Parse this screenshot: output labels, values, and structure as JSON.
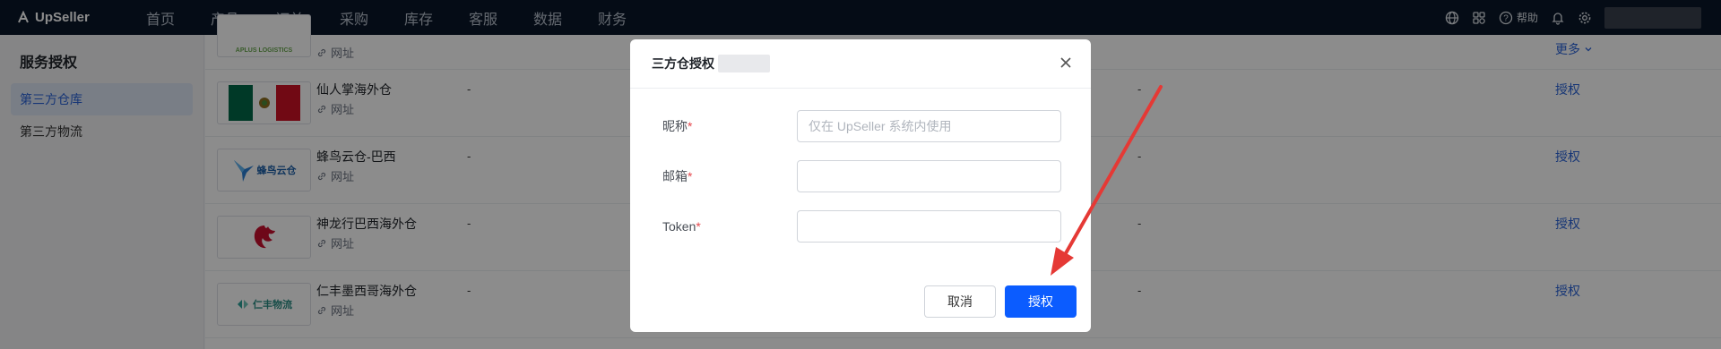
{
  "brand": {
    "name": "UpSeller"
  },
  "nav": [
    "首页",
    "产品",
    "订单",
    "采购",
    "库存",
    "客服",
    "数据",
    "财务"
  ],
  "top_right": {
    "help_label": "帮助"
  },
  "sidebar": {
    "title": "服务授权",
    "items": [
      {
        "label": "第三方仓库",
        "active": true
      },
      {
        "label": "第三方物流",
        "active": false
      }
    ]
  },
  "table": {
    "more_label": "更多",
    "rows": [
      {
        "name": "",
        "link": "网址",
        "col1": "",
        "col2": "",
        "action": ""
      },
      {
        "name": "仙人掌海外仓",
        "link": "网址",
        "col1": "-",
        "col2": "-",
        "action": "授权"
      },
      {
        "name": "蜂鸟云仓-巴西",
        "link": "网址",
        "col1": "-",
        "col2": "-",
        "action": "授权"
      },
      {
        "name": "神龙行巴西海外仓",
        "link": "网址",
        "col1": "-",
        "col2": "-",
        "action": "授权"
      },
      {
        "name": "仁丰墨西哥海外仓",
        "link": "网址",
        "col1": "-",
        "col2": "-",
        "action": "授权"
      }
    ],
    "logos": {
      "row0": "APLUS LOGISTICS",
      "row2": "蜂鸟云仓",
      "row4": "仁丰物流"
    }
  },
  "modal": {
    "title": "三方仓授权",
    "fields": {
      "nickname_label": "昵称",
      "nickname_placeholder": "仅在 UpSeller 系统内使用",
      "email_label": "邮箱",
      "token_label": "Token"
    },
    "cancel_label": "取消",
    "confirm_label": "授权"
  },
  "colors": {
    "primary": "#0b5cff",
    "link": "#2a63d8",
    "annotation": "#e53935"
  }
}
